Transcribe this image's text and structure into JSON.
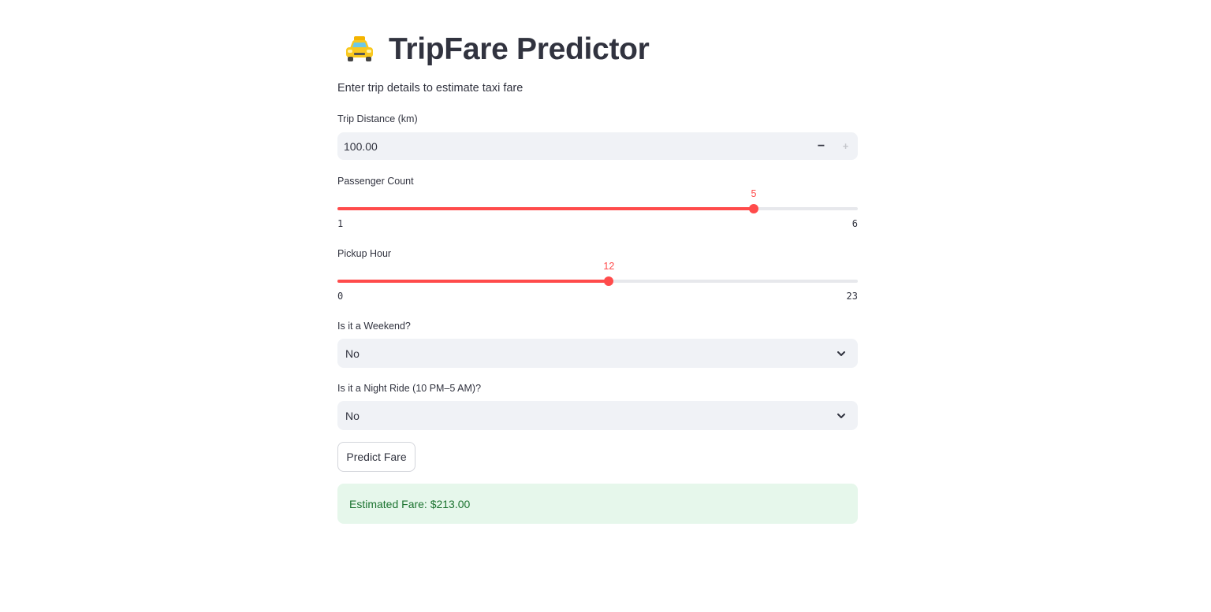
{
  "header": {
    "icon": "taxi-icon",
    "title": "TripFare Predictor",
    "subtitle": "Enter trip details to estimate taxi fare"
  },
  "form": {
    "trip_distance": {
      "label": "Trip Distance (km)",
      "value": "100.00",
      "decrement_label": "−",
      "increment_label": "+"
    },
    "passenger_count": {
      "label": "Passenger Count",
      "value": 5,
      "value_label": "5",
      "min": 1,
      "max": 6,
      "min_label": "1",
      "max_label": "6"
    },
    "pickup_hour": {
      "label": "Pickup Hour",
      "value": 12,
      "value_label": "12",
      "min": 0,
      "max": 23,
      "min_label": "0",
      "max_label": "23"
    },
    "weekend": {
      "label": "Is it a Weekend?",
      "selected": "No"
    },
    "night_ride": {
      "label": "Is it a Night Ride (10 PM–5 AM)?",
      "selected": "No"
    },
    "predict_button": "Predict Fare"
  },
  "result": {
    "text": "Estimated Fare: $213.00"
  },
  "colors": {
    "accent": "#ff4b4b",
    "success_bg": "#e6f7eb",
    "success_text": "#1d7431",
    "input_bg": "#f0f2f6",
    "text": "#31333f"
  }
}
